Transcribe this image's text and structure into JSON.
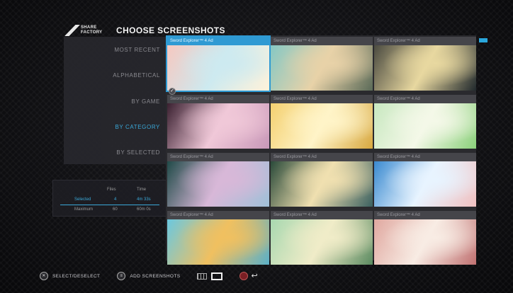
{
  "header": {
    "logo_line1": "SHARE",
    "logo_line2": "FACTORY",
    "title": "CHOOSE SCREENSHOTS"
  },
  "sort": {
    "items": [
      "MOST RECENT",
      "ALPHABETICAL",
      "BY GAME",
      "BY CATEGORY",
      "BY SELECTED"
    ],
    "active_index": 3
  },
  "stats": {
    "col_files": "Files",
    "col_time": "Time",
    "row1_label": "Selected",
    "row1_files": "4",
    "row1_time": "4m 33s",
    "row2_label": "Maximum",
    "row2_files": "60",
    "row2_time": "60m 0s"
  },
  "grid": {
    "caption": "Sword Explorer™ 4 Ad",
    "selected_caption": "Sword Explorer™ 4 Ad",
    "check_mark": "✓",
    "tiles": [
      {
        "selected": true,
        "colors": [
          "#f6c8c0",
          "#cdeaf0",
          "#fff2da"
        ]
      },
      {
        "selected": false,
        "colors": [
          "#86c8c4",
          "#e8d2a8",
          "#5a6a58"
        ]
      },
      {
        "selected": false,
        "colors": [
          "#4a4a40",
          "#e8d8a0",
          "#20282c"
        ]
      },
      {
        "selected": false,
        "colors": [
          "#3a2030",
          "#f0c8d8",
          "#c898b8"
        ]
      },
      {
        "selected": false,
        "colors": [
          "#f4d070",
          "#fff4c8",
          "#d8a840"
        ]
      },
      {
        "selected": false,
        "colors": [
          "#c8e8c0",
          "#f4f8e8",
          "#8ad07a"
        ]
      },
      {
        "selected": false,
        "colors": [
          "#204a48",
          "#d8b8d8",
          "#a0c0d8"
        ]
      },
      {
        "selected": false,
        "colors": [
          "#2a4a3a",
          "#f0e0b0",
          "#3a6060"
        ]
      },
      {
        "selected": false,
        "colors": [
          "#3a8ad0",
          "#e8f4ff",
          "#f0c0c0"
        ]
      },
      {
        "selected": false,
        "colors": [
          "#6ac8e0",
          "#f0c060",
          "#5ab0c8"
        ]
      },
      {
        "selected": false,
        "colors": [
          "#a8d8b0",
          "#f0ecc8",
          "#5a8a60"
        ]
      },
      {
        "selected": false,
        "colors": [
          "#e0a8a0",
          "#f8ece4",
          "#c07070"
        ]
      }
    ]
  },
  "footer": {
    "select_label": "SELECT/DESELECT",
    "add_label": "ADD SCREENSHOTS"
  },
  "colors": {
    "accent": "#2f9ad3",
    "background": "#0b0b0d"
  }
}
